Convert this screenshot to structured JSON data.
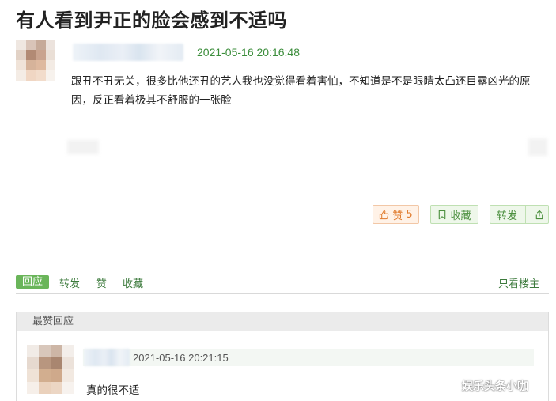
{
  "page": {
    "title": "有人看到尹正的脸会感到不适吗"
  },
  "post": {
    "timestamp": "2021-05-16 20:16:48",
    "content": "跟丑不丑无关，很多比他还丑的艺人我也没觉得看着害怕，不知道是不是眼睛太凸还目露凶光的原因，反正看着极其不舒服的一张脸",
    "actions": {
      "like_label": "赞",
      "like_count": "5",
      "favorite_label": "收藏",
      "share_label": "转发"
    }
  },
  "tabs": {
    "reply": "回应",
    "forward": "转发",
    "like": "赞",
    "favorite": "收藏",
    "owner_only": "只看楼主"
  },
  "replies": {
    "header": "最赞回应",
    "items": [
      {
        "timestamp": "2021-05-16 20:21:15",
        "text": "真的很不适"
      }
    ]
  },
  "watermark": "娱乐头条小咖",
  "colors": {
    "accent_green": "#6ab55a",
    "timestamp_green": "#3b8d3b",
    "like_orange": "#e07a2b"
  }
}
